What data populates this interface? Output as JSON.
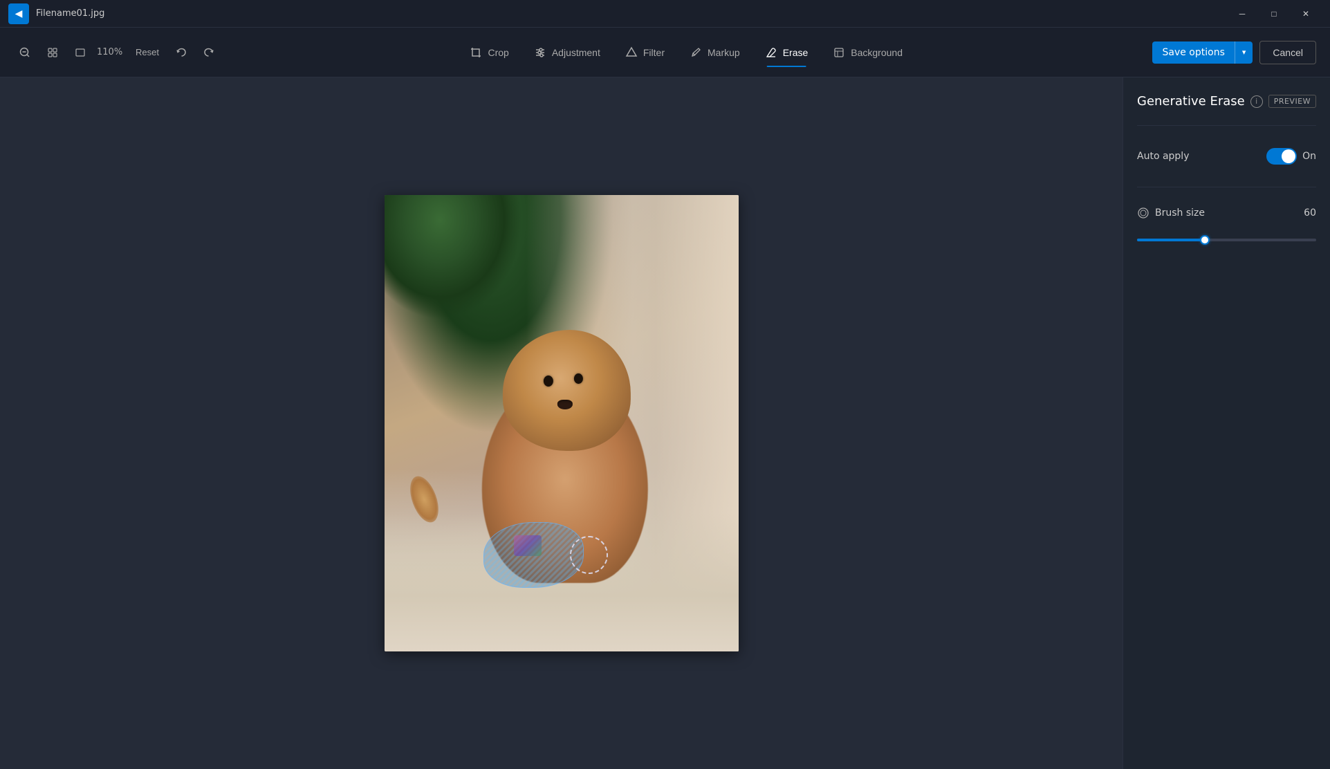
{
  "titlebar": {
    "filename": "Filename01.jpg",
    "back_icon": "◀",
    "minimize_icon": "─",
    "maximize_icon": "□",
    "close_icon": "✕"
  },
  "toolbar": {
    "zoom_out_icon": "🔍",
    "fit_icon": "⊡",
    "aspect_icon": "▣",
    "zoom_level": "110%",
    "reset_label": "Reset",
    "undo_icon": "↩",
    "redo_icon": "↪",
    "tools": [
      {
        "id": "crop",
        "label": "Crop",
        "icon": "⊡"
      },
      {
        "id": "adjustment",
        "label": "Adjustment",
        "icon": "✦"
      },
      {
        "id": "filter",
        "label": "Filter",
        "icon": "⬡"
      },
      {
        "id": "markup",
        "label": "Markup",
        "icon": "✏"
      },
      {
        "id": "erase",
        "label": "Erase",
        "icon": "◈",
        "active": true
      },
      {
        "id": "background",
        "label": "Background",
        "icon": "❖"
      }
    ],
    "save_options_label": "Save options",
    "cancel_label": "Cancel"
  },
  "panel": {
    "title": "Generative Erase",
    "info_icon": "i",
    "preview_badge": "PREVIEW",
    "auto_apply_label": "Auto apply",
    "toggle_state": "On",
    "brush_size_label": "Brush size",
    "brush_size_value": "60",
    "slider_percent": 38
  }
}
